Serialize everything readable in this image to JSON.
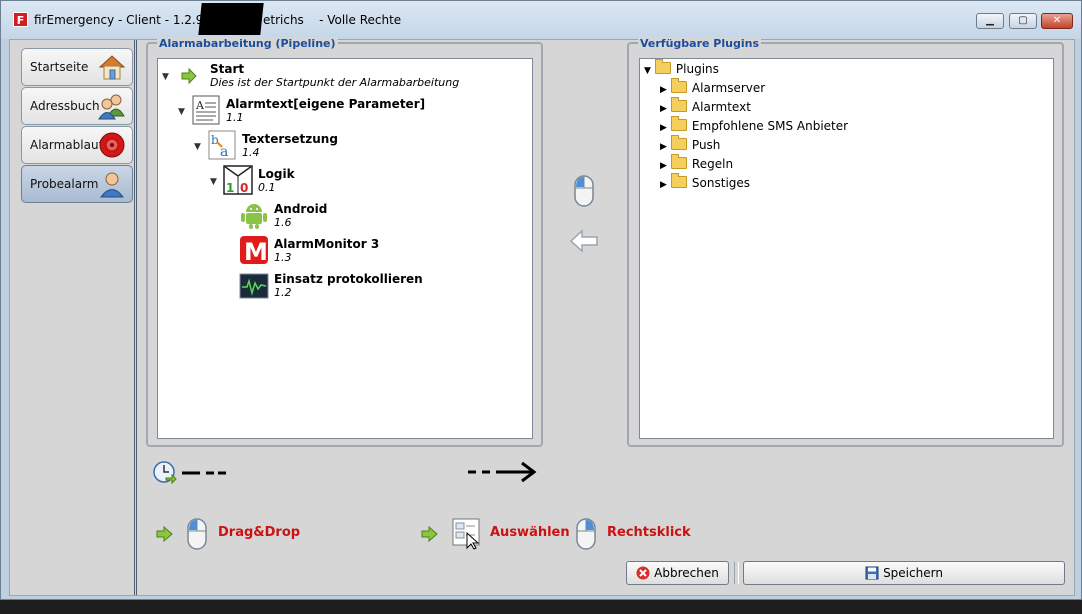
{
  "window": {
    "title_prefix": "firEmergency - Client - 1.2.9.6 - ",
    "title_suffix": "etrichs    - Volle Rechte",
    "app_icon_letter": "F",
    "controls": {
      "minimize": "▁",
      "maximize": "▢",
      "close": "✕"
    }
  },
  "sidebar": {
    "items": [
      {
        "label": "Startseite",
        "icon": "house-icon"
      },
      {
        "label": "Adressbuch",
        "icon": "contacts-icon"
      },
      {
        "label": "Alarmablauf",
        "icon": "alarm-bell-icon"
      },
      {
        "label": "Probealarm",
        "icon": "user-icon",
        "active": true
      }
    ]
  },
  "pipeline": {
    "title": "Alarmabarbeitung (Pipeline)",
    "nodes": [
      {
        "name": "Start",
        "sub": "Dies ist der Startpunkt der Alarmabarbeitung"
      },
      {
        "name": "Alarmtext[eigene Parameter]",
        "sub": "1.1"
      },
      {
        "name": "Textersetzung",
        "sub": "1.4"
      },
      {
        "name": "Logik",
        "sub": "0.1",
        "logic_digits": [
          "1",
          "0"
        ]
      },
      {
        "name": "Android",
        "sub": "1.6"
      },
      {
        "name": "AlarmMonitor 3",
        "sub": "1.3",
        "icon_letter": "M"
      },
      {
        "name": "Einsatz protokollieren",
        "sub": "1.2"
      }
    ]
  },
  "plugins": {
    "title": "Verfügbare Plugins",
    "root": "Plugins",
    "folders": [
      "Alarmserver",
      "Alarmtext",
      "Empfohlene SMS Anbieter",
      "Push",
      "Regeln",
      "Sonstiges"
    ]
  },
  "legend": {
    "drag_drop": "Drag&Drop",
    "select": "Auswählen",
    "right_click": "Rechtsklick"
  },
  "buttons": {
    "cancel": "Abbrechen",
    "save": "Speichern"
  },
  "colors": {
    "accent": "#1b4d9d",
    "legend_red": "#cc1111"
  }
}
